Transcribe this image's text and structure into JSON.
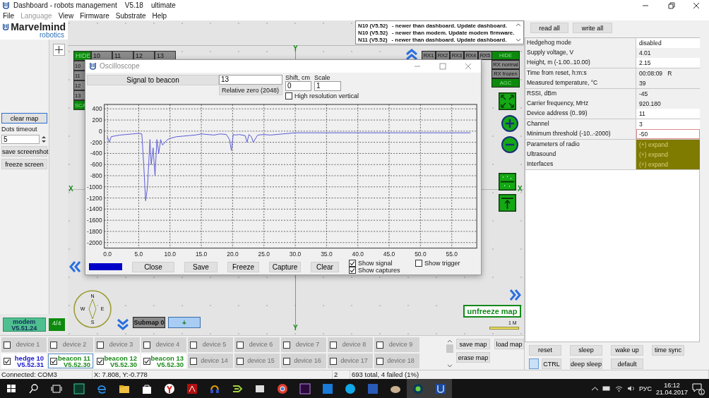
{
  "window": {
    "title": "Dashboard - robots management",
    "version": "V5.18",
    "edition": "ultimate"
  },
  "menu": [
    {
      "label": "File",
      "disabled": false
    },
    {
      "label": "Language",
      "disabled": true
    },
    {
      "label": "View",
      "disabled": false
    },
    {
      "label": "Firmware",
      "disabled": false
    },
    {
      "label": "Substrate",
      "disabled": false
    },
    {
      "label": "Help",
      "disabled": false
    }
  ],
  "logo": {
    "name": "Marvelmind",
    "tagline": "robotics"
  },
  "left_panel": {
    "clear_button": "clear map",
    "dots_timeout": {
      "label": "Dots timeout",
      "value": "5"
    },
    "buttons": [
      "save screenshot",
      "freeze screen"
    ],
    "modem": {
      "name": "modem",
      "version": "V5.51.24"
    },
    "count": "4/4"
  },
  "messages": [
    {
      "source": "N10 (V5.52)",
      "text": "- newer than dashboard. Update dashboard."
    },
    {
      "source": "N10 (V5.52)",
      "text": "- newer than modem. Update modem firmware."
    },
    {
      "source": "N11 (V5.52)",
      "text": "- newer than dashboard. Update dashboard."
    }
  ],
  "map": {
    "beacon_table": {
      "hide": "HIDE",
      "columns": [
        "10",
        "11",
        "12",
        "13"
      ],
      "rows": [
        "10",
        "11",
        "12",
        "13",
        "SCA"
      ]
    },
    "axis_labels": {
      "top": "Y",
      "left": "X",
      "right": "X",
      "bottom": "Y"
    },
    "rx_tabs": [
      "RX1",
      "RX2",
      "RX3",
      "RX4",
      "RX5"
    ],
    "rx_modes": [
      {
        "label": "HIDE",
        "on": true
      },
      {
        "label": "RX normal",
        "on": false
      },
      {
        "label": "RX frozen",
        "on": false
      },
      {
        "label": "AGC",
        "on": true
      }
    ],
    "compass": {
      "north": "N",
      "west": "W",
      "east": "E",
      "south": "S"
    },
    "submap": {
      "label": "Submap 0",
      "add": "+"
    },
    "unfreeze_button": "unfreeze map",
    "scale_label": "1 M"
  },
  "oscilloscope": {
    "title": "Oscilloscope",
    "signal_button": "Signal to beacon",
    "beacon": "13",
    "mode": "Relative zero (2048)",
    "shift": {
      "label": "Shift, cm",
      "value": "0"
    },
    "scale": {
      "label": "Scale",
      "value": "1"
    },
    "high_resolution": {
      "label": "High resolution vertical",
      "checked": false
    },
    "chart_data": {
      "type": "line",
      "x": [
        0,
        0.3,
        0.6,
        1,
        2,
        3,
        4,
        5,
        5.5,
        5.8,
        6.1,
        6.4,
        6.8,
        7.0,
        7.3,
        7.6,
        7.9,
        8.2,
        8.5,
        8.8,
        9.2,
        9.6,
        10,
        11,
        12,
        13,
        14,
        15,
        16,
        17,
        18,
        19,
        19.5,
        19.8,
        20.1,
        20.5,
        21,
        22,
        22.3,
        22.6,
        23,
        23.3,
        24,
        25,
        26,
        28,
        30,
        35,
        40,
        45,
        50,
        55,
        58
      ],
      "values": [
        -100,
        -200,
        -100,
        -90,
        -70,
        -60,
        -50,
        -40,
        -50,
        -600,
        -1250,
        -1000,
        -150,
        -600,
        -300,
        -800,
        -150,
        -400,
        -150,
        -250,
        -200,
        -150,
        -130,
        -100,
        -90,
        -80,
        -70,
        -50,
        -60,
        -70,
        -50,
        -60,
        -150,
        -350,
        -60,
        -70,
        -60,
        -80,
        -200,
        -60,
        -100,
        -200,
        -70,
        -60,
        -70,
        -50,
        -30,
        -30,
        -30,
        -30,
        -30,
        -30,
        -30
      ],
      "grid": true,
      "xlim": [
        -0.5,
        59
      ],
      "ylim": [
        -2100,
        480
      ],
      "xticks": [
        {
          "value": 0,
          "label": "0.0"
        },
        {
          "value": 5,
          "label": "5.0"
        },
        {
          "value": 10,
          "label": "10.0"
        },
        {
          "value": 15,
          "label": "15.0"
        },
        {
          "value": 20,
          "label": "20.0"
        },
        {
          "value": 25,
          "label": "25.0"
        },
        {
          "value": 30,
          "label": "30.0"
        },
        {
          "value": 35,
          "label": "35.0"
        },
        {
          "value": 40,
          "label": "40.0"
        },
        {
          "value": 45,
          "label": "45.0"
        },
        {
          "value": 50,
          "label": "50.0"
        },
        {
          "value": 55,
          "label": "55.0"
        }
      ],
      "yticks": [
        400,
        200,
        0,
        -200,
        -400,
        -600,
        -800,
        -1000,
        -1200,
        -1400,
        -1600,
        -1800,
        -2000
      ]
    },
    "buttons": [
      "Close",
      "Save",
      "Freeze",
      "Capture",
      "Clear"
    ],
    "options": [
      {
        "label": "Show signal",
        "checked": true
      },
      {
        "label": "Show captures",
        "checked": true
      },
      {
        "label": "Show trigger",
        "checked": false
      }
    ]
  },
  "devices": [
    {
      "label": "device 1",
      "kind": "empty",
      "checked": false,
      "selected": false
    },
    {
      "label": "device 2",
      "kind": "empty",
      "checked": false,
      "selected": false
    },
    {
      "label": "device 3",
      "kind": "empty",
      "checked": false,
      "selected": false
    },
    {
      "label": "device 4",
      "kind": "empty",
      "checked": false,
      "selected": false
    },
    {
      "label": "device 5",
      "kind": "empty",
      "checked": false,
      "selected": false
    },
    {
      "label": "device 6",
      "kind": "empty",
      "checked": false,
      "selected": false
    },
    {
      "label": "device 7",
      "kind": "empty",
      "checked": false,
      "selected": false
    },
    {
      "label": "device 8",
      "kind": "empty",
      "checked": false,
      "selected": false
    },
    {
      "label": "device 9",
      "kind": "empty",
      "checked": false,
      "selected": false
    },
    {
      "label": "hedge 10",
      "version": "V5.52.31",
      "kind": "hedge",
      "checked": true,
      "selected": false
    },
    {
      "label": "beacon 11",
      "version": "V5.52.30",
      "kind": "beacon",
      "checked": true,
      "selected": true
    },
    {
      "label": "beacon 12",
      "version": "V5.52.30",
      "kind": "beacon",
      "checked": true,
      "selected": false
    },
    {
      "label": "beacon 13",
      "version": "V5.52.30",
      "kind": "beacon",
      "checked": true,
      "selected": false
    },
    {
      "label": "device 14",
      "kind": "empty",
      "checked": false,
      "selected": false
    },
    {
      "label": "device 15",
      "kind": "empty",
      "checked": false,
      "selected": false
    },
    {
      "label": "device 16",
      "kind": "empty",
      "checked": false,
      "selected": false
    },
    {
      "label": "device 17",
      "kind": "empty",
      "checked": false,
      "selected": false
    },
    {
      "label": "device 18",
      "kind": "empty",
      "checked": false,
      "selected": false
    }
  ],
  "map_buttons": [
    "save map",
    "load map",
    "erase map"
  ],
  "settings": {
    "buttons": [
      "read all",
      "write all"
    ],
    "rows": [
      {
        "label": "Hedgehog mode",
        "value": "disabled",
        "kind": "value",
        "editable": true,
        "focused": false
      },
      {
        "label": "Supply voltage, V",
        "value": "4.01",
        "kind": "value",
        "editable": false,
        "focused": false
      },
      {
        "label": "Height, m (-1.00..10.00)",
        "value": "2.15",
        "kind": "value",
        "editable": true,
        "focused": false
      },
      {
        "label": "Time from reset, h:m:s",
        "value": "00:08:09   R",
        "kind": "value",
        "editable": false,
        "focused": false
      },
      {
        "label": "Measured temperature, °C",
        "value": "39",
        "kind": "value",
        "editable": false,
        "focused": false
      },
      {
        "label": "RSSI, dBm",
        "value": "-45",
        "kind": "value",
        "editable": false,
        "focused": false
      },
      {
        "label": "Carrier frequency, MHz",
        "value": "920.180",
        "kind": "value",
        "editable": false,
        "focused": false
      },
      {
        "label": "Device address (0..99)",
        "value": "11",
        "kind": "value",
        "editable": true,
        "focused": false
      },
      {
        "label": "Channel",
        "value": "3",
        "kind": "value",
        "editable": true,
        "focused": false
      },
      {
        "label": "Minimum threshold (-10..-2000)",
        "value": "-50",
        "kind": "value",
        "editable": true,
        "focused": true
      },
      {
        "label": "Parameters of radio",
        "value": "(+) expand",
        "kind": "expand",
        "focused": false
      },
      {
        "label": "Ultrasound",
        "value": "(+) expand",
        "kind": "expand",
        "focused": false
      },
      {
        "label": "Interfaces",
        "value": "(+) expand",
        "kind": "expand",
        "focused": false
      }
    ],
    "actions": [
      {
        "label": "reset",
        "kind": "button"
      },
      {
        "label": "sleep",
        "kind": "button"
      },
      {
        "label": "wake up",
        "kind": "button"
      },
      {
        "label": "time sync",
        "kind": "button"
      },
      {
        "label": "CTRL",
        "kind": "toggle"
      },
      {
        "label": "deep sleep",
        "kind": "button"
      },
      {
        "label": "default",
        "kind": "button"
      }
    ]
  },
  "status_bar": [
    "Connected: COM3",
    "X: 7.808, Y:-0.778",
    "2",
    "693 total, 4 failed (1%)"
  ],
  "taskbar": {
    "language": "РУС",
    "time": "16:12",
    "date": "21.04.2017",
    "notifications": "1"
  }
}
